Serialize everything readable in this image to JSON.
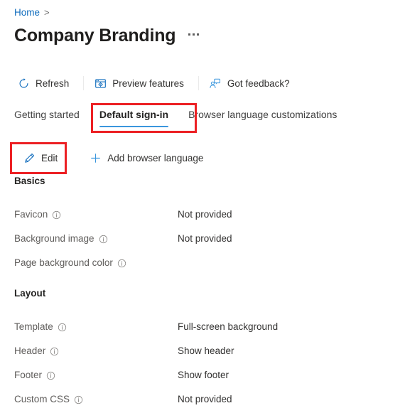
{
  "breadcrumb": {
    "items": [
      {
        "label": "Home",
        "icon": "none"
      }
    ],
    "separator": ">"
  },
  "header": {
    "title": "Company Branding",
    "more_icon": "ellipsis-icon",
    "more_label": "More commands"
  },
  "commandbar": {
    "items": [
      {
        "label": "Refresh",
        "icon": "refresh-icon"
      },
      {
        "label": "Preview features",
        "icon": "preview-features-icon"
      },
      {
        "label": "Got feedback?",
        "icon": "feedback-icon"
      }
    ]
  },
  "tabs": [
    {
      "label": "Getting started",
      "active": false
    },
    {
      "label": "Default sign-in",
      "active": true
    },
    {
      "label": "Browser language customizations",
      "active": false
    }
  ],
  "actionbar": {
    "items": [
      {
        "label": "Edit",
        "icon": "pencil-icon"
      },
      {
        "label": "Add browser language",
        "icon": "plus-icon"
      }
    ]
  },
  "sections": [
    {
      "title": "Basics",
      "rows": [
        {
          "label": "Favicon",
          "info_icon": "info-icon",
          "value": "Not provided"
        },
        {
          "label": "Background image",
          "info_icon": "info-icon",
          "value": "Not provided"
        },
        {
          "label": "Page background color",
          "info_icon": "info-icon",
          "value": ""
        }
      ]
    },
    {
      "title": "Layout",
      "rows": [
        {
          "label": "Template",
          "info_icon": "info-icon",
          "value": "Full-screen background"
        },
        {
          "label": "Header",
          "info_icon": "info-icon",
          "value": "Show header"
        },
        {
          "label": "Footer",
          "info_icon": "info-icon",
          "value": "Show footer"
        },
        {
          "label": "Custom CSS",
          "info_icon": "info-icon",
          "value": "Not provided"
        }
      ]
    }
  ],
  "annotations": [
    {
      "name": "default-sign-in-tab-highlight",
      "color": "#ec2024"
    },
    {
      "name": "edit-button-highlight",
      "color": "#ec2024"
    }
  ],
  "colors": {
    "link": "#0f6cbd",
    "accent_underline": "#3a96dd",
    "icon_blue": "#0f6cbd",
    "annotation_red": "#ec2024",
    "label_gray": "#605e5c",
    "value_dark": "#323130",
    "background": "#ffffff"
  }
}
